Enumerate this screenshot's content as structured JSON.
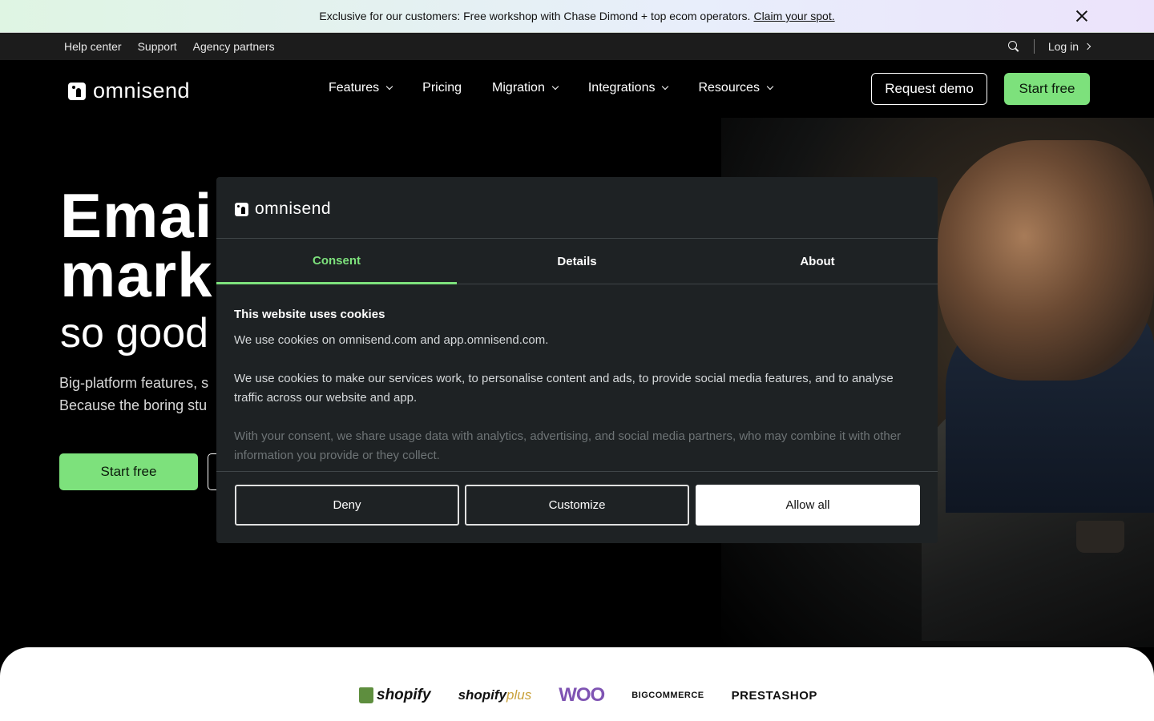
{
  "announcement": {
    "text": "Exclusive for our customers: Free workshop with Chase Dimond + top ecom operators.",
    "link": "Claim your spot."
  },
  "utility": {
    "links": [
      "Help center",
      "Support",
      "Agency partners"
    ],
    "login": "Log in"
  },
  "nav": {
    "logo": "omnisend",
    "items": [
      "Features",
      "Pricing",
      "Migration",
      "Integrations",
      "Resources"
    ],
    "request_demo": "Request demo",
    "start_free": "Start free"
  },
  "hero": {
    "title_line1": "Emai",
    "title_line2": "mark",
    "subtitle": "so good",
    "desc_line1": "Big-platform features, s",
    "desc_line2": "Because the boring stu",
    "start_free": "Start free"
  },
  "partners": {
    "shopify": "shopify",
    "shopifyplus_a": "shopify",
    "shopifyplus_b": "plus",
    "woo": "WOO",
    "bigcommerce": "BIGCOMMERCE",
    "prestashop": "PRESTASHOP"
  },
  "cookie_modal": {
    "logo": "omnisend",
    "tabs": [
      "Consent",
      "Details",
      "About"
    ],
    "heading": "This website uses cookies",
    "p1": "We use cookies on omnisend.com and app.omnisend.com.",
    "p2": "We use cookies to make our services work, to personalise content and ads, to provide social media features, and to analyse traffic across our website and app.",
    "p3": "With your consent, we share usage data with analytics, advertising, and social media partners, who may combine it with other information you provide or they collect.",
    "deny": "Deny",
    "customize": "Customize",
    "allow_all": "Allow all"
  },
  "colors": {
    "accent": "#7de17c",
    "modal_bg": "#1e2224",
    "utility_bg": "#1c1c1c"
  }
}
